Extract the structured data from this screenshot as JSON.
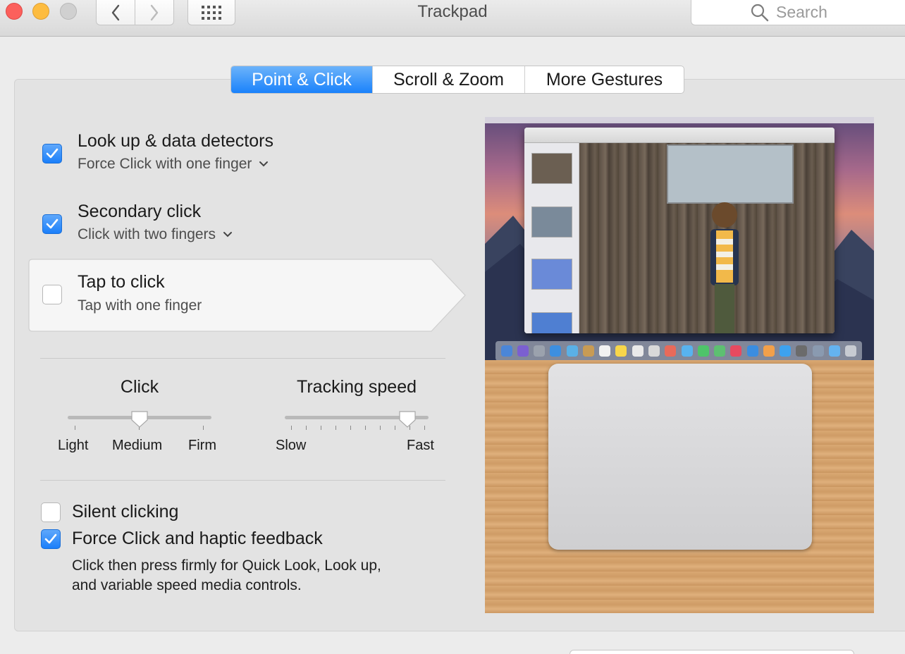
{
  "window": {
    "title": "Trackpad"
  },
  "search": {
    "placeholder": "Search"
  },
  "tabs": [
    {
      "label": "Point & Click",
      "active": true
    },
    {
      "label": "Scroll & Zoom",
      "active": false
    },
    {
      "label": "More Gestures",
      "active": false
    }
  ],
  "options": {
    "lookup": {
      "label": "Look up & data detectors",
      "sublabel": "Force Click with one finger",
      "checked": true
    },
    "secondary": {
      "label": "Secondary click",
      "sublabel": "Click with two fingers",
      "checked": true
    },
    "tap": {
      "label": "Tap to click",
      "sublabel": "Tap with one finger",
      "checked": false
    }
  },
  "click_slider": {
    "title": "Click",
    "labels": [
      "Light",
      "Medium",
      "Firm"
    ],
    "value": "Medium"
  },
  "tracking_slider": {
    "title": "Tracking speed",
    "min_label": "Slow",
    "max_label": "Fast",
    "level": 0.875
  },
  "silent": {
    "label": "Silent clicking",
    "checked": false
  },
  "force": {
    "label": "Force Click and haptic feedback",
    "checked": true,
    "description_line1": "Click then press firmly for Quick Look, Look up,",
    "description_line2": "and variable speed media controls."
  },
  "colors": {
    "accent": "#1b7ffa",
    "window_bg": "#ececec",
    "panel_bg": "#e3e3e3"
  }
}
